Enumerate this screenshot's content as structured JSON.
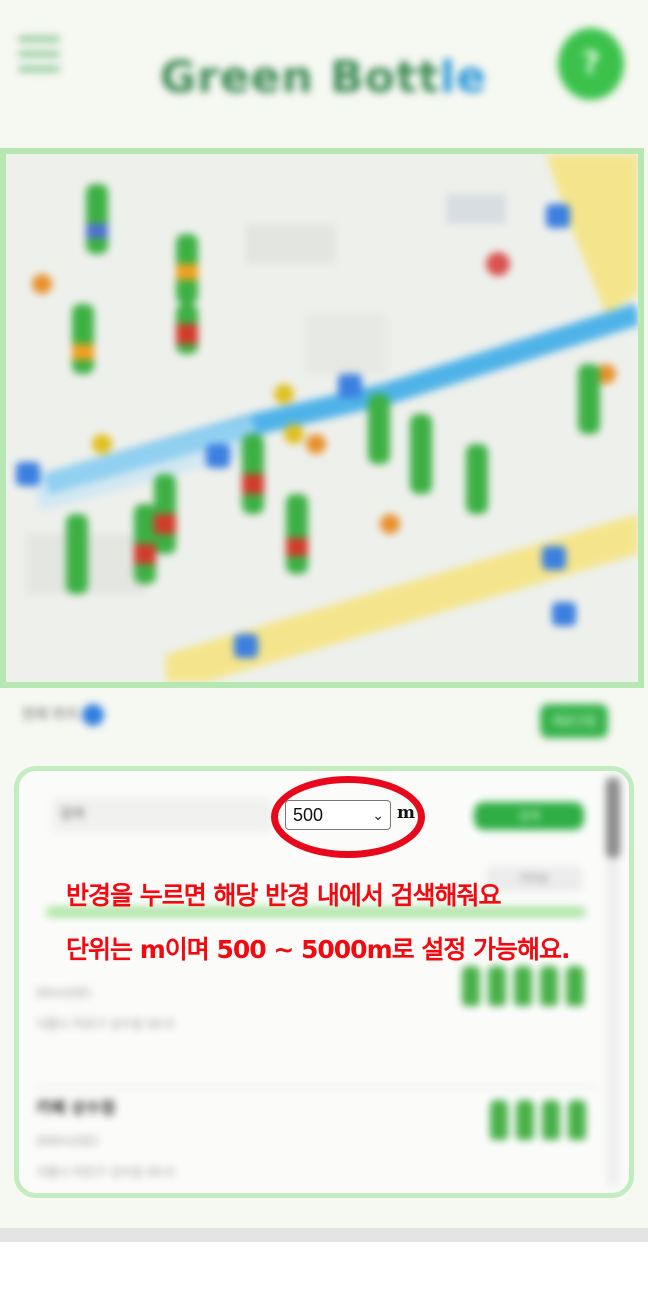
{
  "header": {
    "logo_text": "Green Bott",
    "logo_accent": "le",
    "help_label": "?",
    "menu_icon": "hamburger-icon"
  },
  "map": {
    "pins": "bottle-marker-icon",
    "colors": {
      "border": "#b7e8b3",
      "pin_green": "#3cb043",
      "pin_red": "#d23b2b",
      "subway": "#4fb3e8",
      "road": "#f4e58c"
    }
  },
  "location": {
    "label": "현재 위치",
    "refresh_label": "새로고침"
  },
  "search": {
    "input_placeholder": "검색",
    "radius_value": "500",
    "radius_unit": "m",
    "button_label": "검색",
    "sort_label": "거리순"
  },
  "annotation": {
    "line1": "반경을 누르면 해당 반경 내에서 검색해줘요",
    "line2": "단위는 m이며 500 ~ 5000m로 설정 가능해요.",
    "color": "#f20a10"
  },
  "results": [
    {
      "name": "",
      "distance": "00m(0분)",
      "address": "서울시 마포구 상수동 00-0"
    },
    {
      "name": "카페 상수점",
      "distance": "000m(0분)",
      "address": "서울시 마포구 상수동 00-0"
    }
  ]
}
